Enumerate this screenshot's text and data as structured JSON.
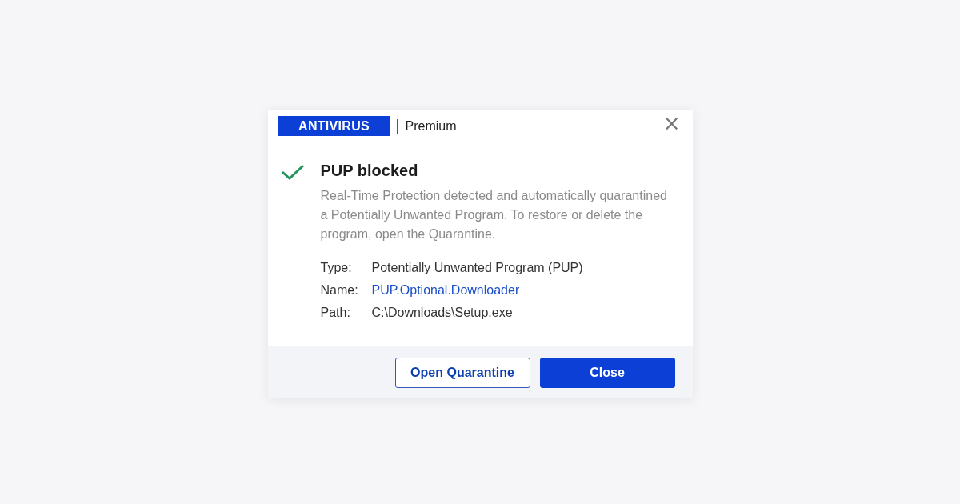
{
  "dialog": {
    "brand": "ANTIVIRUS",
    "edition": "Premium",
    "close_glyph": "×",
    "title": "PUP blocked",
    "message": "Real-Time Protection detected and automatically quarantined a Potentially Unwanted Program. To restore or delete the program, open the Quarantine.",
    "details": [
      {
        "label": "Type:",
        "value": "Potentially Unwanted Program (PUP)",
        "kind": "text"
      },
      {
        "label": "Name:",
        "value": "PUP.Optional.Downloader",
        "kind": "link"
      },
      {
        "label": "Path:",
        "value": "C:\\Downloads\\Setup.exe",
        "kind": "text"
      }
    ],
    "buttons": [
      {
        "label": "Open Quarantine",
        "kind": "secondary"
      },
      {
        "label": "Close",
        "kind": "primary"
      }
    ]
  }
}
